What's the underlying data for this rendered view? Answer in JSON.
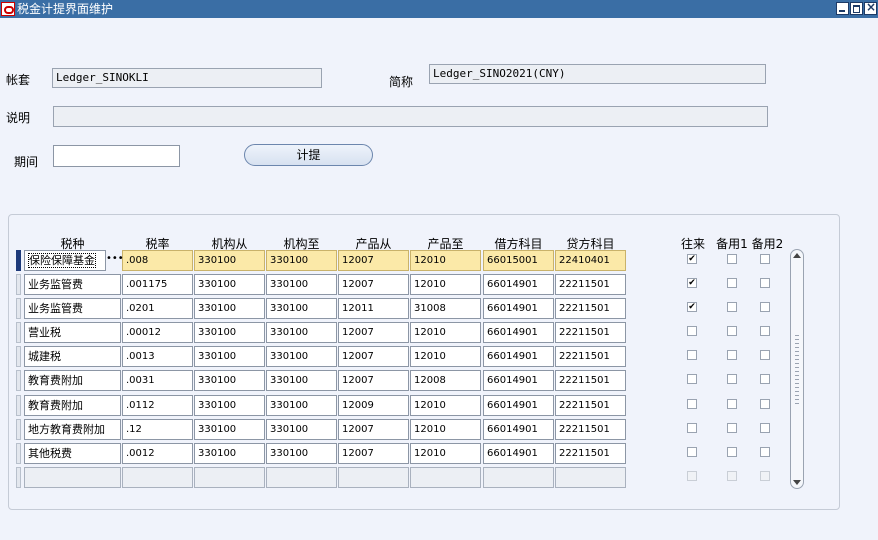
{
  "window": {
    "title": "税金计提界面维护"
  },
  "form": {
    "ledger_label": "帐套",
    "ledger_value": "Ledger_SINOKLI",
    "short_label": "简称",
    "short_value": "Ledger_SINO2021(CNY)",
    "desc_label": "说明",
    "desc_value": "",
    "period_label": "期间",
    "period_value": "",
    "accrue_button": "计提"
  },
  "table": {
    "headers": {
      "tax_type": "税种",
      "rate": "税率",
      "org_from": "机构从",
      "org_to": "机构至",
      "prod_from": "产品从",
      "prod_to": "产品至",
      "debit": "借方科目",
      "credit": "贷方科目",
      "intercompany": "往来",
      "spare1": "备用1",
      "spare2": "备用2"
    },
    "rows": [
      {
        "tax_type": "保险保障基金",
        "rate": ".008",
        "org_from": "330100",
        "org_to": "330100",
        "prod_from": "12007",
        "prod_to": "12010",
        "debit": "66015001",
        "credit": "22410401",
        "intercompany": true,
        "spare1": false,
        "spare2": false
      },
      {
        "tax_type": "业务监管费",
        "rate": ".001175",
        "org_from": "330100",
        "org_to": "330100",
        "prod_from": "12007",
        "prod_to": "12010",
        "debit": "66014901",
        "credit": "22211501",
        "intercompany": true,
        "spare1": false,
        "spare2": false
      },
      {
        "tax_type": "业务监管费",
        "rate": ".0201",
        "org_from": "330100",
        "org_to": "330100",
        "prod_from": "12011",
        "prod_to": "31008",
        "debit": "66014901",
        "credit": "22211501",
        "intercompany": true,
        "spare1": false,
        "spare2": false
      },
      {
        "tax_type": "营业税",
        "rate": ".00012",
        "org_from": "330100",
        "org_to": "330100",
        "prod_from": "12007",
        "prod_to": "12010",
        "debit": "66014901",
        "credit": "22211501",
        "intercompany": false,
        "spare1": false,
        "spare2": false
      },
      {
        "tax_type": "城建税",
        "rate": ".0013",
        "org_from": "330100",
        "org_to": "330100",
        "prod_from": "12007",
        "prod_to": "12010",
        "debit": "66014901",
        "credit": "22211501",
        "intercompany": false,
        "spare1": false,
        "spare2": false
      },
      {
        "tax_type": "教育费附加",
        "rate": ".0031",
        "org_from": "330100",
        "org_to": "330100",
        "prod_from": "12007",
        "prod_to": "12008",
        "debit": "66014901",
        "credit": "22211501",
        "intercompany": false,
        "spare1": false,
        "spare2": false
      },
      {
        "tax_type": "教育费附加",
        "rate": ".0112",
        "org_from": "330100",
        "org_to": "330100",
        "prod_from": "12009",
        "prod_to": "12010",
        "debit": "66014901",
        "credit": "22211501",
        "intercompany": false,
        "spare1": false,
        "spare2": false
      },
      {
        "tax_type": "地方教育费附加",
        "rate": ".12",
        "org_from": "330100",
        "org_to": "330100",
        "prod_from": "12007",
        "prod_to": "12010",
        "debit": "66014901",
        "credit": "22211501",
        "intercompany": false,
        "spare1": false,
        "spare2": false
      },
      {
        "tax_type": "其他税费",
        "rate": ".0012",
        "org_from": "330100",
        "org_to": "330100",
        "prod_from": "12007",
        "prod_to": "12010",
        "debit": "66014901",
        "credit": "22211501",
        "intercompany": false,
        "spare1": false,
        "spare2": false
      },
      {
        "tax_type": "",
        "rate": "",
        "org_from": "",
        "org_to": "",
        "prod_from": "",
        "prod_to": "",
        "debit": "",
        "credit": "",
        "intercompany": false,
        "spare1": false,
        "spare2": false
      }
    ]
  }
}
